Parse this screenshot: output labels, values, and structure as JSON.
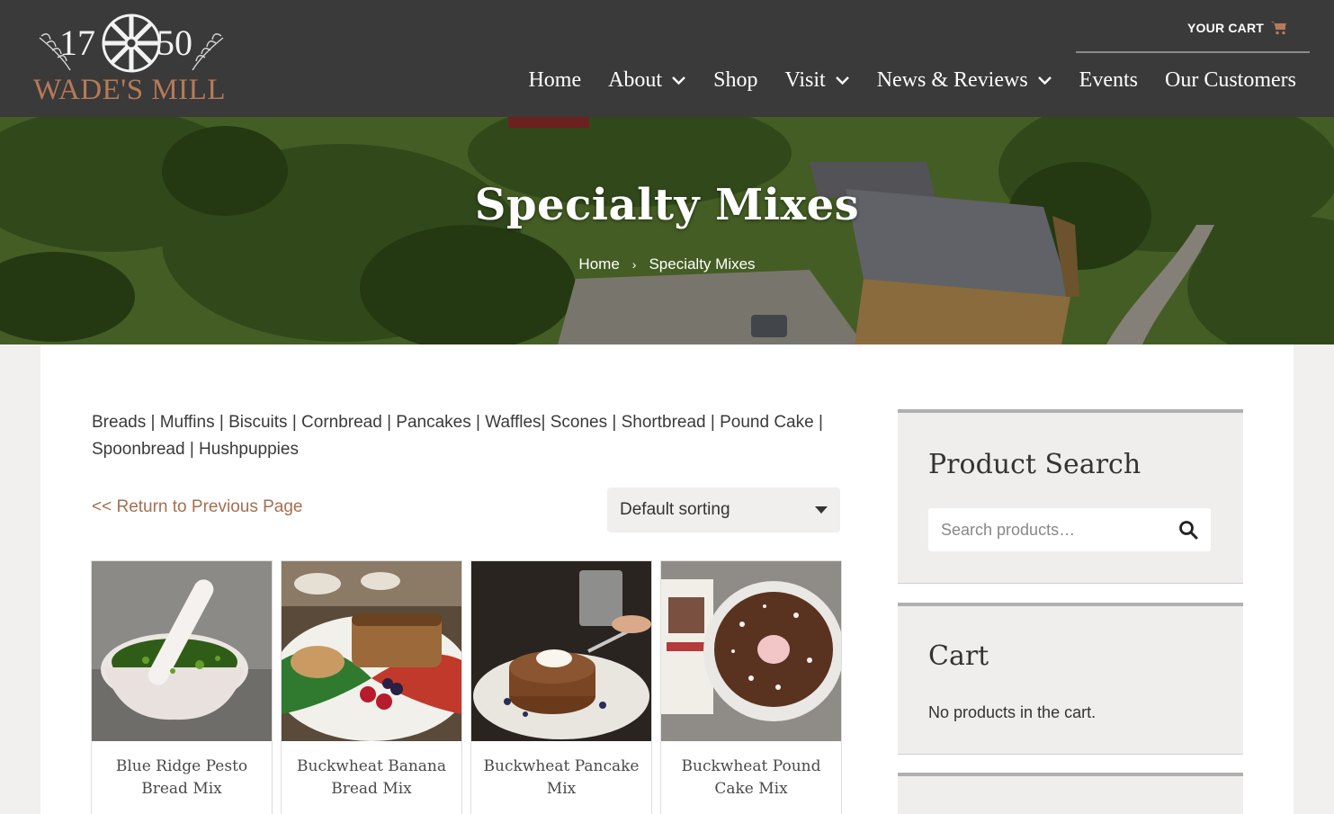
{
  "brand": {
    "year_left": "17",
    "year_right": "50",
    "name": "WADE'S MILL",
    "accent": "#b77a58"
  },
  "header": {
    "cart_label": "YOUR CART",
    "cart_icon": "shopping-cart-icon",
    "nav": [
      {
        "label": "Home",
        "dropdown": false
      },
      {
        "label": "About",
        "dropdown": true
      },
      {
        "label": "Shop",
        "dropdown": false
      },
      {
        "label": "Visit",
        "dropdown": true
      },
      {
        "label": "News & Reviews",
        "dropdown": true
      },
      {
        "label": "Events",
        "dropdown": false
      },
      {
        "label": "Our Customers",
        "dropdown": false
      }
    ]
  },
  "hero": {
    "title": "Specialty Mixes",
    "breadcrumb": {
      "home": "Home",
      "separator": "›",
      "current": "Specialty Mixes"
    }
  },
  "main": {
    "category_links": "Breads | Muffins | Biscuits | Cornbread | Pancakes | Waffles| Scones | Shortbread | Pound Cake | Spoonbread | Hushpuppies",
    "return_link": "<< Return to Previous Page",
    "sort_selected": "Default sorting",
    "products": [
      {
        "name": "Blue Ridge Pesto Bread Mix",
        "image": "pesto-mortar-photo"
      },
      {
        "name": "Buckwheat Banana Bread Mix",
        "image": "banana-bread-photo"
      },
      {
        "name": "Buckwheat Pancake Mix",
        "image": "pancake-stack-photo"
      },
      {
        "name": "Buckwheat Pound Cake Mix",
        "image": "bundt-cake-photo"
      }
    ]
  },
  "sidebar": {
    "search": {
      "title": "Product Search",
      "placeholder": "Search products…",
      "icon": "search-icon"
    },
    "cart": {
      "title": "Cart",
      "empty_text": "No products in the cart."
    }
  }
}
